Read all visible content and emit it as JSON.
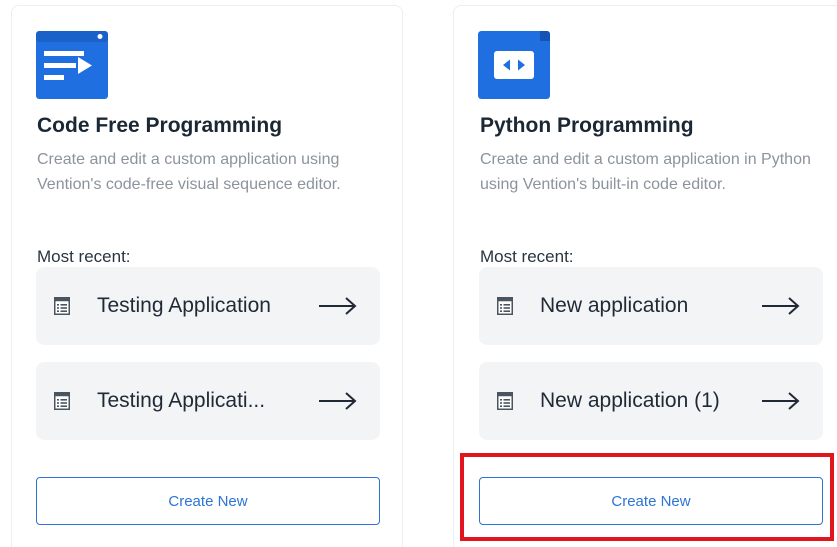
{
  "cards": {
    "code_free": {
      "title": "Code Free Programming",
      "description": "Create and edit a custom application using Vention's code-free visual sequence editor.",
      "recent_label": "Most recent:",
      "recent": [
        {
          "name": "Testing Application"
        },
        {
          "name": "Testing Applicati..."
        }
      ],
      "create_label": "Create New",
      "icon": "sequence-editor-icon"
    },
    "python": {
      "title": "Python Programming",
      "description": "Create and edit a custom application in Python using Vention's built-in code editor.",
      "recent_label": "Most recent:",
      "recent": [
        {
          "name": "New application"
        },
        {
          "name": "New application (1)"
        }
      ],
      "create_label": "Create New",
      "icon": "code-editor-icon"
    }
  },
  "colors": {
    "accent": "#2c74d6",
    "icon_blue": "#1f6fe0",
    "highlight": "#e0161c",
    "item_bg": "#f3f4f6"
  }
}
